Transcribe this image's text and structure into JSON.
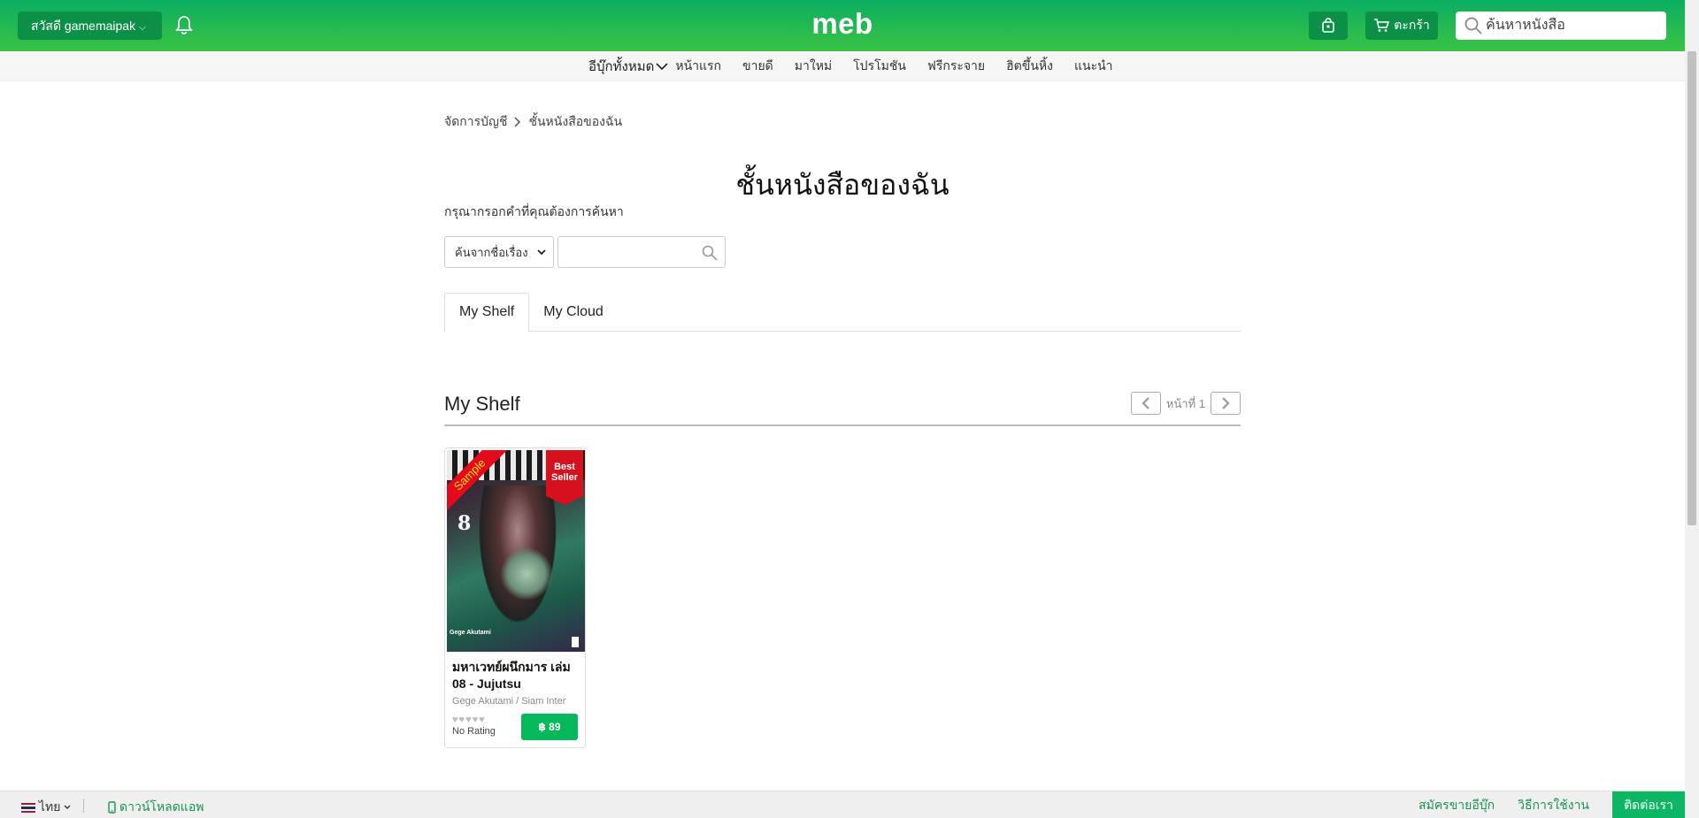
{
  "header": {
    "greeting": "สวัสดี gamemaipak",
    "logo": "meb",
    "cart_label": "ตะกร้า",
    "search_placeholder": "ค้นหาหนังสือ",
    "brand_color": "#0aae62"
  },
  "nav": {
    "all_ebooks": "อีบุ๊กทั้งหมด",
    "items": [
      "หน้าแรก",
      "ขายดี",
      "มาใหม่",
      "โปรโมชัน",
      "ฟรีกระจาย",
      "ฮิตขึ้นหิ้ง",
      "แนะนำ"
    ]
  },
  "breadcrumb": {
    "parent": "จัดการบัญชี",
    "current": "ชั้นหนังสือของฉัน"
  },
  "page": {
    "title": "ชั้นหนังสือของฉัน",
    "prompt": "กรุณากรอกคำที่คุณต้องการค้นหา",
    "search_by": "ค้นจากชื่อเรื่อง",
    "search_value": ""
  },
  "tabs": [
    "My Shelf",
    "My Cloud"
  ],
  "shelf": {
    "title": "My Shelf",
    "page_label": "หน้าที่ 1"
  },
  "books": [
    {
      "ribbon": "Sample",
      "badge_line1": "Best",
      "badge_line2": "Seller",
      "cover_volume": "8",
      "cover_author": "Gege Akutami",
      "title": "มหาเวทย์ผนึกมาร เล่ม 08 - Jujutsu",
      "author": "Gege Akutami / Siam Inter",
      "rating_text": "No Rating",
      "rating": 0,
      "price": "฿ 89"
    }
  ],
  "footer": {
    "language": "ไทย",
    "download_app": "ดาวน์โหลดแอพ",
    "seller_signup": "สมัครขายอีบุ๊ก",
    "how_to": "วิธีการใช้งาน",
    "contact": "ติดต่อเรา"
  }
}
